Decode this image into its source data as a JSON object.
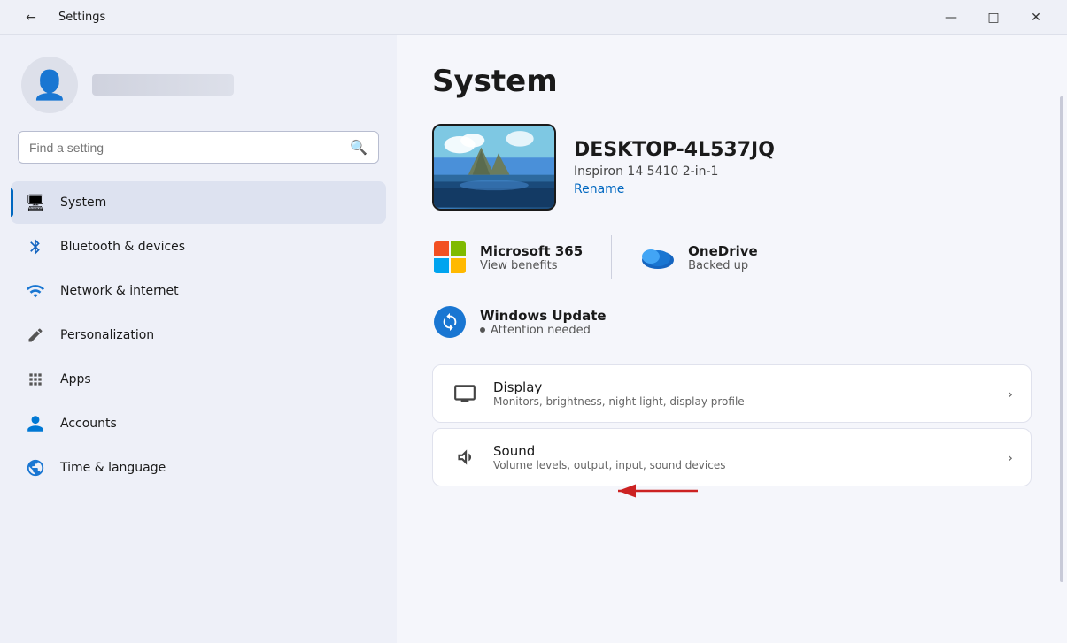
{
  "titlebar": {
    "title": "Settings",
    "back_icon": "←",
    "minimize_icon": "—",
    "maximize_icon": "□",
    "close_icon": "✕"
  },
  "sidebar": {
    "search": {
      "placeholder": "Find a setting",
      "icon": "⌕"
    },
    "profile": {
      "username_placeholder": ""
    },
    "nav_items": [
      {
        "id": "system",
        "label": "System",
        "icon": "🖥",
        "active": true
      },
      {
        "id": "bluetooth",
        "label": "Bluetooth & devices",
        "icon": "🔵",
        "active": false
      },
      {
        "id": "network",
        "label": "Network & internet",
        "icon": "📶",
        "active": false
      },
      {
        "id": "personalization",
        "label": "Personalization",
        "icon": "✏️",
        "active": false
      },
      {
        "id": "apps",
        "label": "Apps",
        "icon": "🪟",
        "active": false
      },
      {
        "id": "accounts",
        "label": "Accounts",
        "icon": "👤",
        "active": false
      },
      {
        "id": "time",
        "label": "Time & language",
        "icon": "🌐",
        "active": false
      }
    ]
  },
  "main": {
    "page_title": "System",
    "device": {
      "name": "DESKTOP-4L537JQ",
      "model": "Inspiron 14 5410 2-in-1",
      "rename_label": "Rename"
    },
    "info_cards": [
      {
        "id": "microsoft365",
        "title": "Microsoft 365",
        "subtitle": "View benefits"
      },
      {
        "id": "onedrive",
        "title": "OneDrive",
        "subtitle": "Backed up"
      }
    ],
    "update": {
      "title": "Windows Update",
      "subtitle": "Attention needed"
    },
    "settings_rows": [
      {
        "id": "display",
        "title": "Display",
        "subtitle": "Monitors, brightness, night light, display profile"
      },
      {
        "id": "sound",
        "title": "Sound",
        "subtitle": "Volume levels, output, input, sound devices"
      }
    ]
  }
}
